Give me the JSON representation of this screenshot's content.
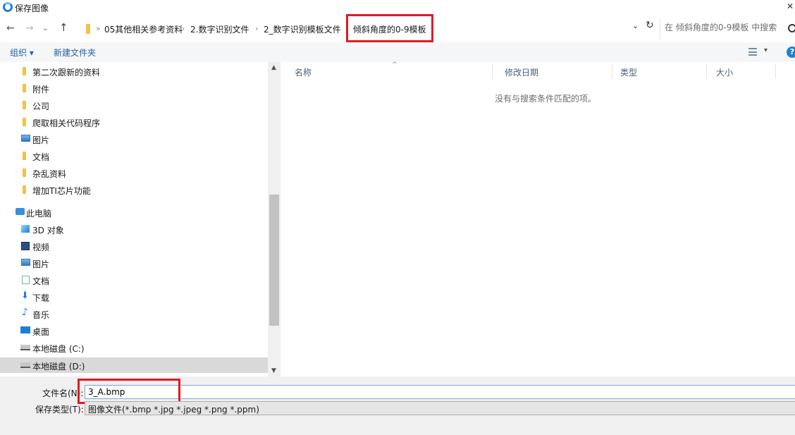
{
  "window": {
    "title": "保存图像"
  },
  "nav": {
    "back": "←",
    "forward": "→",
    "recent": "⌄",
    "up": "↑",
    "breadcrumbs": [
      "05其他相关参考资料",
      "2.数字识别文件",
      "2_数字识别模板文件",
      "倾斜角度的0-9模板"
    ],
    "refresh": "↻",
    "chevron": "⌄"
  },
  "search": {
    "placeholder": "在 倾斜角度的0-9模板 中搜索"
  },
  "toolbar": {
    "organize": "组织 ▾",
    "new_folder": "新建文件夹",
    "view_drop": "▾",
    "help": "?"
  },
  "sidebar": {
    "items": [
      {
        "label": "第二次跟新的资料",
        "icon": "folder-icon"
      },
      {
        "label": "附件",
        "icon": "folder-icon"
      },
      {
        "label": "公司",
        "icon": "folder-icon"
      },
      {
        "label": "爬取相关代码程序",
        "icon": "folder-icon"
      },
      {
        "label": "图片",
        "icon": "pictures-icon"
      },
      {
        "label": "文档",
        "icon": "folder-icon"
      },
      {
        "label": "杂乱资料",
        "icon": "folder-icon"
      },
      {
        "label": "增加TI芯片功能",
        "icon": "folder-icon"
      },
      {
        "label": "此电脑",
        "icon": "computer-icon"
      },
      {
        "label": "3D 对象",
        "icon": "3d-objects-icon"
      },
      {
        "label": "视频",
        "icon": "video-icon"
      },
      {
        "label": "图片",
        "icon": "pictures-icon"
      },
      {
        "label": "文档",
        "icon": "document-icon"
      },
      {
        "label": "下载",
        "icon": "download-icon"
      },
      {
        "label": "音乐",
        "icon": "music-icon"
      },
      {
        "label": "桌面",
        "icon": "desktop-icon"
      },
      {
        "label": "本地磁盘 (C:)",
        "icon": "drive-icon"
      },
      {
        "label": "本地磁盘 (D:)",
        "icon": "drive-icon"
      }
    ],
    "selected": "本地磁盘 (D:)"
  },
  "file_list": {
    "columns": [
      "名称",
      "修改日期",
      "类型",
      "大小"
    ],
    "empty_message": "没有与搜索条件匹配的项。"
  },
  "save_form": {
    "filename_label": "文件名(N):",
    "filename_value": "3_A.bmp",
    "type_label": "保存类型(T):",
    "type_value": "图像文件(*.bmp *.jpg *.jpeg *.png *.ppm)"
  },
  "colors": {
    "accent": "#1f7fd6",
    "highlight_box": "#e01b24",
    "link": "#1f5fa8"
  }
}
